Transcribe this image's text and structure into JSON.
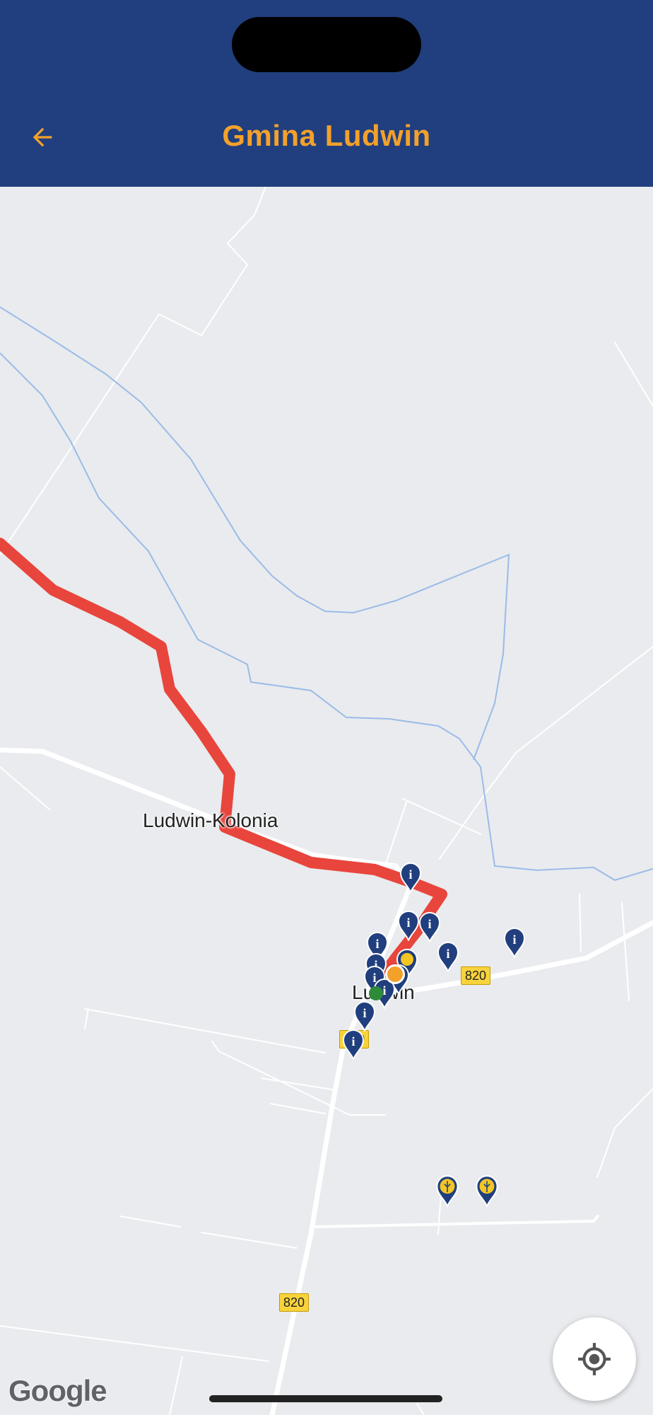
{
  "header": {
    "title": "Gmina Ludwin",
    "back_icon": "arrow-left-icon",
    "background": "#213f7e",
    "accent": "#f3a12b"
  },
  "map": {
    "places": {
      "ludwin_kolonia": "Ludwin-Kolonia",
      "ludwin": "Ludwin"
    },
    "road_badges": {
      "east": "820",
      "center": "820",
      "south": "820"
    },
    "route_color": "#e8453c",
    "marker_color": "#213f7e",
    "poi_color": "#f3c623"
  },
  "controls": {
    "locate_icon": "my-location-icon"
  },
  "attribution": {
    "google": "Google"
  }
}
